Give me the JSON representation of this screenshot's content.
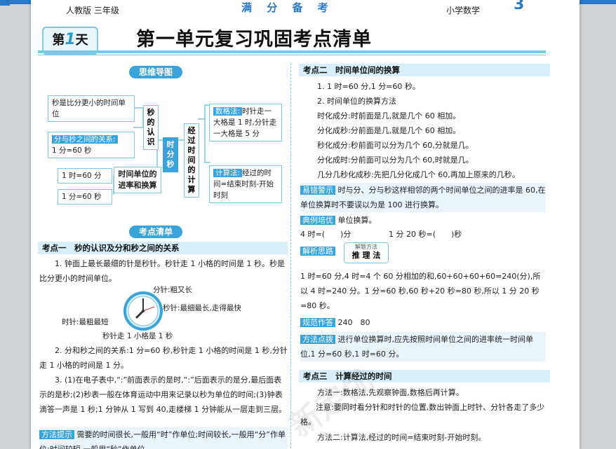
{
  "header": {
    "left": "人教版 三年级",
    "center": "满 分 备 考",
    "right": "小学数学",
    "page_number": "3"
  },
  "day": {
    "prefix": "第",
    "number": "1",
    "suffix": "天"
  },
  "title": "第一单元复习巩固考点清单",
  "mindmap": {
    "heading": "思维导图",
    "box1": "秒是比分更小的时间单位",
    "box2_tag": "分与秒之间的关系:",
    "box2_text": "1 分=60 秒",
    "node_miao": "秒的认识",
    "node_center": "时分秒",
    "node_jingguo": "经过时间的计算",
    "box3_tag": "数格法:",
    "box3_text": "时针走一大格是 1 时,分针走一大格是 5 分",
    "box4_tag": "计算法:",
    "box4_text": "经过的时间=结束时刻-开始时刻",
    "unit1": "1 时=60 分",
    "unit2": "1 分=60 秒",
    "node_danwei": "时间单位的进率和换算"
  },
  "checklist": {
    "heading": "考点清单",
    "k1_title": "考点一　秒的认识及分和秒之间的关系",
    "k1_p1": "1. 钟面上最长最细的针是秒针。秒针走 1 小格的时间是 1 秒。秒是比分更小的时间单位。",
    "clock_fen": "分针:粗又长",
    "clock_miao": "秒针:最细最长,走得最快",
    "clock_shi": "时针:最粗最短",
    "clock_step": "秒针走 1 小格是 1 秒",
    "k1_p2": "2. 分和秒之间的关系:1 分=60 秒,秒针走 1 小格的时间是 1 秒,分针走 1 小格的时间是 1 分。",
    "k1_p3": "3. (1)在电子表中,“:”前面表示的是时,“:”后面表示的是分,最后面表示的是秒;(2)秒表一般在体育运动中用来记录以秒为单位的时间;(3)钟表滴答一声是 1 秒;1 分钟从 1 写到 40,走楼梯 1 分钟能从一层走到三层。",
    "tip_tag": "方法提示",
    "tip_text": "需要的时间很长,一般用“时”作单位;时间较长,一般用“分”作单位;时间较短,一般用“秒”作单位。"
  },
  "right": {
    "k2_title": "考点二　时间单位间的换算",
    "k2_l1": "1. 1 时=60 分,1 分=60 秒。",
    "k2_l2": "2. 时间单位的换算方法",
    "k2_l3": "时化成分:时前面是几,就是几个 60 相加。",
    "k2_l4": "分化成秒:分前面是几,就是几个 60 相加。",
    "k2_l5": "秒化成分:秒前面可以分为几个 60,分就是几。",
    "k2_l6": "分化成时:分前面可以分为几个 60,时就是几。",
    "k2_l7": "几分几秒化成秒:先把几分化成几个 60,再加上原来的几秒。",
    "warn_tag": "易错警示",
    "warn_text": "时与分、分与秒这样相邻的两个时间单位之间的进率是 60,在单位换算时不要误以为是 100 进行换算。",
    "ex_tag": "典例培优",
    "ex_text": "单位换算。",
    "ex_q1": "4 时=(　　)分",
    "ex_q2": "1 分 20 秒=(　　)秒",
    "an_tag": "解析思路",
    "an_small": "解题方法",
    "an_method": "推 理 法",
    "an_text": "1 时=60 分,4 时=4 个 60 分相加的和,60+60+60+60=240(分),所以 4 时=240 分。1 分=60 秒,60 秒+20 秒=80 秒,所以 1 分 20 秒=80 秒。",
    "ans_tag": "规范作答",
    "ans_text": "240　80",
    "m_tag": "方法点拨",
    "m_text": "进行单位换算时,应先按照时间单位之间的进率统一时间单位,1 分=60 秒,1 时=60 分。",
    "k3_title": "考点三　计算经过的时间",
    "k3_l1": "方法一:数格法,先观察钟面,数格后再计算。",
    "k3_l2": "注意:要同时看分针和时针的位置,数出钟面上时针、分针各走了多少格。",
    "k3_l3": "方法二:计算法,经过的时间=结束时刻-开始时刻。"
  },
  "watermark": "新定优",
  "colors": {
    "accent": "#3aa3d9",
    "light": "#d8eef8",
    "border": "#7cc6e6",
    "topbar": "#2a78c8"
  }
}
